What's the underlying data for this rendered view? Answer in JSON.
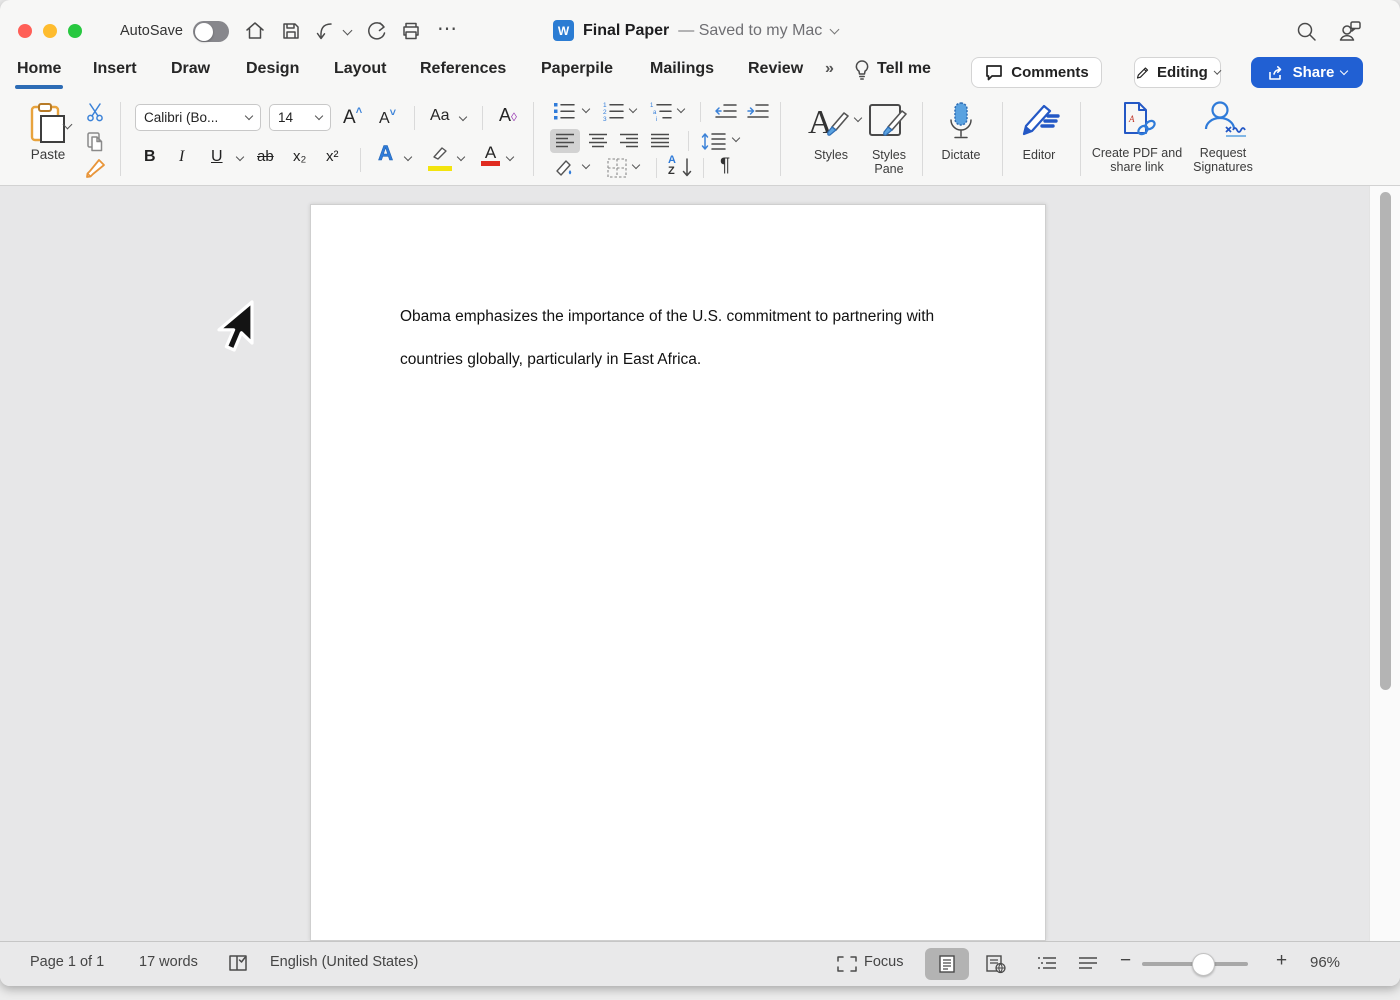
{
  "colors": {
    "accent_blue": "#2d6cb5",
    "share_blue": "#2160d3",
    "icon_blue": "#3b82d8",
    "traffic_red": "#ff5f57",
    "traffic_yellow": "#febc2e",
    "traffic_green": "#28c840",
    "highlight_yellow": "#f3e40e",
    "font_color_red": "#e02b20"
  },
  "titlebar": {
    "autosave_label": "AutoSave",
    "doc_title": "Final Paper",
    "doc_status": "— Saved to my Mac"
  },
  "tabs": [
    {
      "label": "Home",
      "active": true
    },
    {
      "label": "Insert"
    },
    {
      "label": "Draw"
    },
    {
      "label": "Design"
    },
    {
      "label": "Layout"
    },
    {
      "label": "References"
    },
    {
      "label": "Paperpile"
    },
    {
      "label": "Mailings"
    },
    {
      "label": "Review"
    }
  ],
  "tellme": {
    "label": "Tell me"
  },
  "top_actions": {
    "comments_label": "Comments",
    "editing_label": "Editing",
    "share_label": "Share"
  },
  "ribbon": {
    "paste_label": "Paste",
    "font_name": "Calibri (Bo...",
    "font_size": "14",
    "format": {
      "bold": "B",
      "italic": "I",
      "underline": "U",
      "strikethrough": "ab",
      "subscript": "x₂",
      "superscript": "x²",
      "grow_font": "A",
      "shrink_font": "A",
      "change_case": "Aa",
      "clear_format": "A",
      "text_effects": "A",
      "font_color": "A"
    },
    "sort": {
      "a": "A",
      "z": "Z"
    },
    "pilcrow": "¶",
    "styles_label": "Styles",
    "styles_pane_label": "Styles Pane",
    "dictate_label": "Dictate",
    "editor_label": "Editor",
    "create_pdf_label": "Create PDF and share link",
    "request_signatures_label": "Request Signatures"
  },
  "document": {
    "line1": "Obama emphasizes the importance of the U.S. commitment to partnering with",
    "line2": "countries globally, particularly in East Africa."
  },
  "statusbar": {
    "page_info": "Page 1 of 1",
    "word_count": "17 words",
    "language": "English (United States)",
    "focus_label": "Focus",
    "zoom_level": "96%"
  },
  "icons": {
    "ellipsis": "⋯",
    "overflow_chevrons": "»",
    "zoom_out": "−",
    "zoom_in": "+"
  }
}
